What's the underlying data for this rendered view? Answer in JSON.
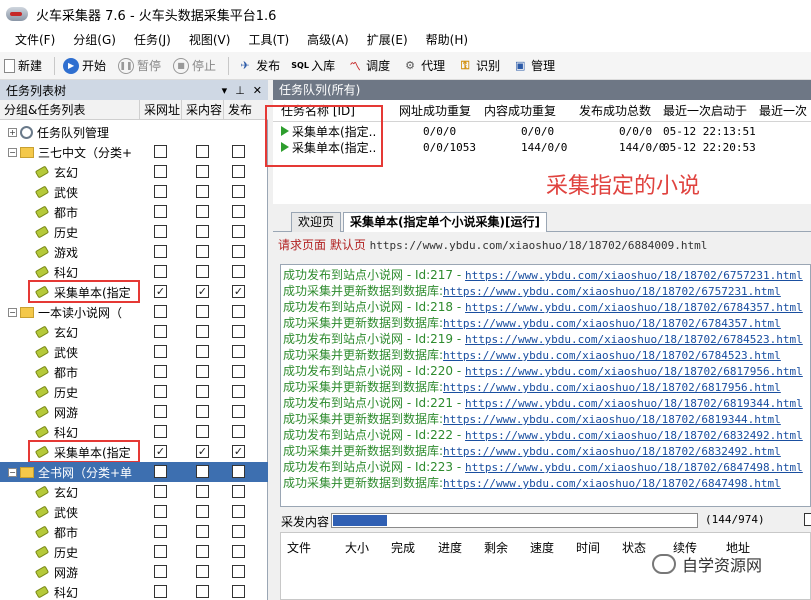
{
  "window": {
    "title": "火车采集器 7.6 - 火车头数据采集平台1.6"
  },
  "menu": [
    "文件(F)",
    "分组(G)",
    "任务(J)",
    "视图(V)",
    "工具(T)",
    "高级(A)",
    "扩展(E)",
    "帮助(H)"
  ],
  "toolbar": {
    "new": "新建",
    "start": "开始",
    "pause": "暂停",
    "stop": "停止",
    "publish": "发布",
    "import": "入库",
    "tune": "调度",
    "proxy": "代理",
    "ocr": "识别",
    "manage": "管理"
  },
  "left_panel": {
    "title": "任务列表树",
    "columns": [
      "分组&任务列表",
      "采网址",
      "采内容",
      "发布"
    ],
    "root": "任务队列管理",
    "rows": [
      {
        "label": "三七中文（分类+",
        "type": "folder"
      },
      {
        "label": "玄幻",
        "type": "task",
        "checks": [
          false,
          false,
          false
        ]
      },
      {
        "label": "武侠",
        "type": "task",
        "checks": [
          false,
          false,
          false
        ]
      },
      {
        "label": "都市",
        "type": "task",
        "checks": [
          false,
          false,
          false
        ]
      },
      {
        "label": "历史",
        "type": "task",
        "checks": [
          false,
          false,
          false
        ]
      },
      {
        "label": "游戏",
        "type": "task",
        "checks": [
          false,
          false,
          false
        ]
      },
      {
        "label": "科幻",
        "type": "task",
        "checks": [
          false,
          false,
          false
        ]
      },
      {
        "label": "采集单本(指定",
        "type": "task",
        "checks": [
          true,
          true,
          true
        ]
      },
      {
        "label": "一本读小说网（",
        "type": "folder"
      },
      {
        "label": "玄幻",
        "type": "task",
        "checks": [
          false,
          false,
          false
        ]
      },
      {
        "label": "武侠",
        "type": "task",
        "checks": [
          false,
          false,
          false
        ]
      },
      {
        "label": "都市",
        "type": "task",
        "checks": [
          false,
          false,
          false
        ]
      },
      {
        "label": "历史",
        "type": "task",
        "checks": [
          false,
          false,
          false
        ]
      },
      {
        "label": "网游",
        "type": "task",
        "checks": [
          false,
          false,
          false
        ]
      },
      {
        "label": "科幻",
        "type": "task",
        "checks": [
          false,
          false,
          false
        ]
      },
      {
        "label": "采集单本(指定",
        "type": "task",
        "checks": [
          true,
          true,
          true
        ]
      },
      {
        "label": "全书网（分类+单",
        "type": "folder",
        "selected": true
      },
      {
        "label": "玄幻",
        "type": "task",
        "checks": [
          false,
          false,
          false
        ]
      },
      {
        "label": "武侠",
        "type": "task",
        "checks": [
          false,
          false,
          false
        ]
      },
      {
        "label": "都市",
        "type": "task",
        "checks": [
          false,
          false,
          false
        ]
      },
      {
        "label": "历史",
        "type": "task",
        "checks": [
          false,
          false,
          false
        ]
      },
      {
        "label": "网游",
        "type": "task",
        "checks": [
          false,
          false,
          false
        ]
      },
      {
        "label": "科幻",
        "type": "task",
        "checks": [
          false,
          false,
          false
        ]
      }
    ]
  },
  "queue": {
    "title": "任务队列(所有)",
    "columns": [
      "任务名称 [ID]",
      "网址成功重复",
      "内容成功重复",
      "发布成功总数",
      "最近一次启动于",
      "最近一次"
    ],
    "rows": [
      {
        "name": "采集单本(指定..",
        "url_stat": "0/0/0",
        "content_stat": "0/0/0",
        "publish_stat": "0/0/0",
        "last_start": "05-12 22:13:51"
      },
      {
        "name": "采集单本(指定..",
        "url_stat": "0/0/1053",
        "content_stat": "144/0/0",
        "publish_stat": "144/0/0",
        "last_start": "05-12 22:20:53"
      }
    ],
    "annotation": "采集指定的小说"
  },
  "tabs": [
    "欢迎页",
    "采集单本(指定单个小说采集)[运行]"
  ],
  "request": {
    "label": "请求页面 默认页",
    "url": "https://www.ybdu.com/xiaoshuo/18/18702/6884009.html"
  },
  "log": [
    {
      "text": "成功发布到站点小说网 - Id:217 - ",
      "url": "https://www.ybdu.com/xiaoshuo/18/18702/6757231.html"
    },
    {
      "text": "成功采集并更新数据到数据库:",
      "url": "https://www.ybdu.com/xiaoshuo/18/18702/6757231.html"
    },
    {
      "text": "成功发布到站点小说网 - Id:218 - ",
      "url": "https://www.ybdu.com/xiaoshuo/18/18702/6784357.html"
    },
    {
      "text": "成功采集并更新数据到数据库:",
      "url": "https://www.ybdu.com/xiaoshuo/18/18702/6784357.html"
    },
    {
      "text": "成功发布到站点小说网 - Id:219 - ",
      "url": "https://www.ybdu.com/xiaoshuo/18/18702/6784523.html"
    },
    {
      "text": "成功采集并更新数据到数据库:",
      "url": "https://www.ybdu.com/xiaoshuo/18/18702/6784523.html"
    },
    {
      "text": "成功发布到站点小说网 - Id:220 - ",
      "url": "https://www.ybdu.com/xiaoshuo/18/18702/6817956.html"
    },
    {
      "text": "成功采集并更新数据到数据库:",
      "url": "https://www.ybdu.com/xiaoshuo/18/18702/6817956.html"
    },
    {
      "text": "成功发布到站点小说网 - Id:221 - ",
      "url": "https://www.ybdu.com/xiaoshuo/18/18702/6819344.html"
    },
    {
      "text": "成功采集并更新数据到数据库:",
      "url": "https://www.ybdu.com/xiaoshuo/18/18702/6819344.html"
    },
    {
      "text": "成功发布到站点小说网 - Id:222 - ",
      "url": "https://www.ybdu.com/xiaoshuo/18/18702/6832492.html"
    },
    {
      "text": "成功采集并更新数据到数据库:",
      "url": "https://www.ybdu.com/xiaoshuo/18/18702/6832492.html"
    },
    {
      "text": "成功发布到站点小说网 - Id:223 - ",
      "url": "https://www.ybdu.com/xiaoshuo/18/18702/6847498.html"
    },
    {
      "text": "成功采集并更新数据到数据库:",
      "url": "https://www.ybdu.com/xiaoshuo/18/18702/6847498.html"
    }
  ],
  "publish": {
    "label": "采发内容",
    "progress_text": "(144/974)",
    "progress_fraction": 0.148
  },
  "file_table": {
    "columns": [
      "文件",
      "大小",
      "完成",
      "进度",
      "剩余",
      "速度",
      "时间",
      "状态",
      "续传",
      "地址"
    ]
  },
  "watermark": "自学资源网"
}
